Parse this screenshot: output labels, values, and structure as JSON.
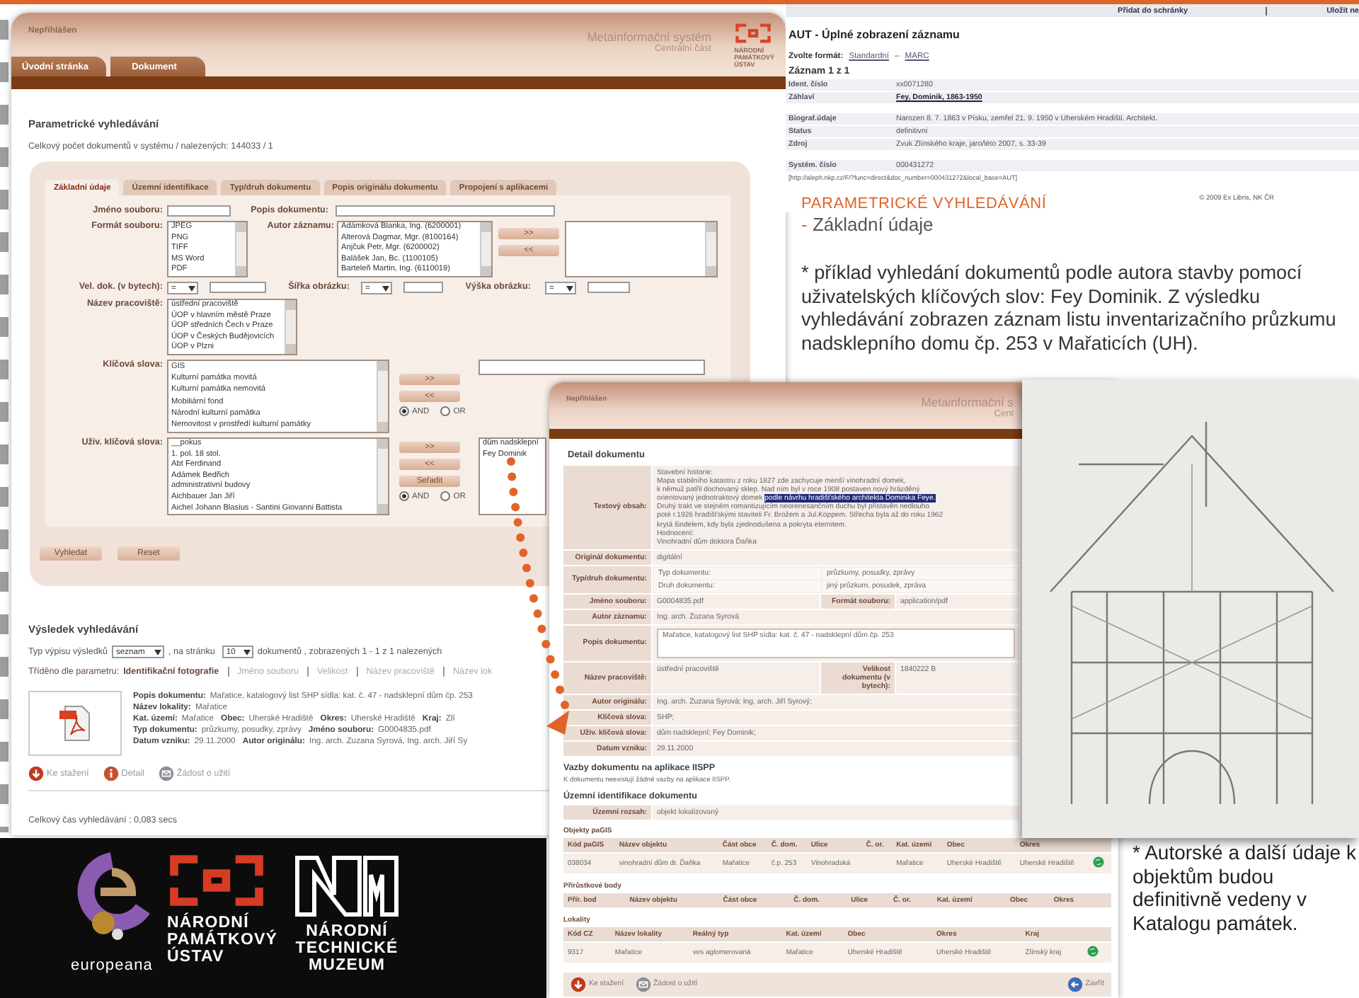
{
  "slide": {
    "heading": "PARAMETRICKÉ VYHLEDÁVÁNÍ",
    "subheading": "- Základní údaje",
    "note": "* příklad vyhledání dokumentů podle autora stavby pomocí uživatelských klíčových slov: Fey Dominik. Z výsledku vyhledávání zobrazen záznam listu inventarizačního průzkumu nadsklepního domu čp. 253 v Mařaticích (UH).",
    "footnote": "* Autorské a další údaje k objektům budou definitivně vedeny v Katalogu památek."
  },
  "search_window": {
    "status": "Nepřihlášen",
    "system_title": "Metainformační systém",
    "system_subtitle": "Centrální část",
    "logo_lines": [
      "NÁRODNÍ",
      "PAMÁTKOVÝ",
      "ÚSTAV"
    ],
    "nav_tabs": [
      "Úvodní stránka",
      "Dokument"
    ],
    "page_title": "Parametrické vyhledávání",
    "count_text": "Celkový počet dokumentů v systému / nalezených: 144033 / 1",
    "form": {
      "tabs": [
        {
          "label": "Základní údaje",
          "selected": true
        },
        {
          "label": "Územní identifikace",
          "selected": false
        },
        {
          "label": "Typ/druh dokumentu",
          "selected": false
        },
        {
          "label": "Popis originálu dokumentu",
          "selected": false
        },
        {
          "label": "Propojení s aplikacemi",
          "selected": false
        }
      ],
      "file_name_label": "Jméno souboru:",
      "description_label": "Popis dokumentu:",
      "format_label": "Formát souboru:",
      "formats": [
        "JPEG",
        "PNG",
        "TIFF",
        "MS Word",
        "PDF"
      ],
      "author_label": "Autor záznamu:",
      "authors": [
        "Adámková Blanka, Ing. (6200001)",
        "Alterová Dagmar, Mgr. (8100164)",
        "Anjčuk Petr, Mgr. (6200002)",
        "Balášek Jan, Bc. (1100105)",
        "Barteleň Martin, Ing. (6110019)"
      ],
      "author_buttons": [
        ">>",
        "<<"
      ],
      "size_label": "Vel. dok. (v bytech):",
      "size_operator": "=",
      "width_label": "Šířka obrázku:",
      "width_operator": "=",
      "height_label": "Výška obrázku:",
      "height_operator": "=",
      "workplace_label": "Název pracoviště:",
      "workplaces": [
        "ústřední pracoviště",
        "ÚOP v hlavním městě Praze",
        "ÚOP středních Čech v Praze",
        "ÚOP v Českých Budějovicích",
        "ÚOP v Plzni"
      ],
      "keywords_label": "Klíčová slova:",
      "keywords": [
        "GIS",
        "Kulturní památka movitá",
        "Kulturní památka nemovitá",
        "Mobiliární fond",
        "Národní kulturní památka",
        "Nemovitost v prostředí kulturní památky"
      ],
      "keyword_buttons": [
        ">>",
        "<<"
      ],
      "keyword_logic": [
        {
          "label": "AND",
          "selected": true
        },
        {
          "label": "OR",
          "selected": false
        }
      ],
      "user_keywords_label": "Uživ. klíčová slova:",
      "user_keywords": [
        "__pokus",
        "1. pol. 18 stol.",
        "Abt Ferdinand",
        "Adámek Bedřich",
        "administrativní budovy",
        "Aichbauer Jan Jiří",
        "Aichel Johann Blasius - Santini Giovanni Battista"
      ],
      "user_keyword_buttons": [
        ">>",
        "<<",
        "Seřadit"
      ],
      "user_keyword_logic": [
        {
          "label": "AND",
          "selected": true
        },
        {
          "label": "OR",
          "selected": false
        }
      ],
      "chosen_user_keywords": [
        "dům nadsklepní",
        "Fey Dominik"
      ],
      "search_button": "Vyhledat",
      "reset_button": "Reset"
    },
    "results": {
      "title": "Výsledek vyhledávání",
      "list_type_label": "Typ výpisu výsledků",
      "list_type": "seznam",
      "per_page_label": ", na stránku",
      "per_page": "10",
      "summary": "dokumentů , zobrazených 1 - 1 z 1 nalezených",
      "sort_label": "Tříděno dle parametru:",
      "sort_options": [
        {
          "label": "Identifikační fotografie",
          "selected": true
        },
        {
          "label": "Jméno souboru",
          "selected": false
        },
        {
          "label": "Velikost",
          "selected": false
        },
        {
          "label": "Název pracoviště",
          "selected": false
        },
        {
          "label": "Název lok",
          "selected": false
        }
      ],
      "item_lines": [
        [
          {
            "label": "Popis dokumentu:",
            "value": "Mařatice, katalogový list SHP sídla: kat. č. 47 - nadsklepní dům čp. 253"
          }
        ],
        [
          {
            "label": "Název lokality:",
            "value": "Mařatice"
          }
        ],
        [
          {
            "label": "Kat. území:",
            "value": "Mařatice"
          },
          {
            "label": "Obec:",
            "value": "Uherské Hradiště"
          },
          {
            "label": "Okres:",
            "value": "Uherské Hradiště"
          },
          {
            "label": "Kraj:",
            "value": "Zlí"
          }
        ],
        [
          {
            "label": "Typ dokumentu:",
            "value": "průzkumy, posudky, zprávy"
          },
          {
            "label": "Jméno souboru:",
            "value": "G0004835.pdf"
          }
        ],
        [
          {
            "label": "Datum vzniku:",
            "value": "29.11.2000"
          },
          {
            "label": "Autor originálu:",
            "value": "Ing. arch. Zuzana Syrová, Ing. arch. Jiří Sy"
          }
        ]
      ],
      "actions": [
        {
          "kind": "download",
          "label": "Ke stažení"
        },
        {
          "kind": "detail",
          "label": "Detail"
        },
        {
          "kind": "request",
          "label": "Žádost o užití"
        }
      ],
      "time": "Celkový čas vyhledávání : 0,083 secs"
    }
  },
  "aut_window": {
    "toolbar": [
      "Přidat do schránky",
      "Uložit ne"
    ],
    "title": "AUT - Úplné zobrazení záznamu",
    "format_label": "Zvolte formát:",
    "formats": [
      "Standardní",
      "MARC"
    ],
    "format_separator": "–",
    "record_count": "Záznam 1 z 1",
    "rows": [
      {
        "kind": "text",
        "label": "Ident. číslo",
        "value": "xx0071280"
      },
      {
        "kind": "link",
        "label": "Záhlaví",
        "value": "Fey, Dominik, 1863-1950"
      },
      {
        "kind": "text",
        "label": "Biograf.údaje",
        "value": "Narozen 8. 7. 1863 v Písku, zemřel 21. 9. 1950 v Uherském Hradišti. Architekt."
      },
      {
        "kind": "text",
        "label": "Status",
        "value": "definitivní"
      },
      {
        "kind": "text",
        "label": "Zdroj",
        "value": "Zvuk Zlínského kraje, jaro/léto 2007, s. 33-39"
      },
      {
        "kind": "text",
        "label": "Systém. číslo",
        "value": "000431272"
      }
    ],
    "url": "[http://aleph.nkp.cz/F/?func=direct&doc_number=000431272&local_base=AUT]",
    "copyright": "© 2009 Ex Libris, NK ČR"
  },
  "detail_window": {
    "status": "Nepřihlášen",
    "system_title": "Metainformační s",
    "system_subtitle": "Cent",
    "title": "Detail dokumentu",
    "rows": [
      {
        "kind": "content",
        "label": "Textový obsah:",
        "lines": [
          [
            {
              "text": "Stavební historie:",
              "highlighted": false
            }
          ],
          [
            {
              "text": "Mapa stabilního katastru z roku 1827 zde zachycuje menší vinohradní domek,",
              "highlighted": false
            }
          ],
          [
            {
              "text": "k němuž patřil dochovaný sklep. Nad ním byl v roce 1908 postaven nový hrázděný",
              "highlighted": false
            }
          ],
          [
            {
              "text": "orientovaný jednotraktový domek ",
              "highlighted": false
            },
            {
              "text": "podle návrhu hradišťského architekta Dominika Feye.",
              "highlighted": true
            }
          ],
          [
            {
              "text": "Druhý trakt ve stejném romantizujícím neorenesančním duchu byl přistavěn nedlouho",
              "highlighted": false
            }
          ],
          [
            {
              "text": "poté r.1926 hradišťskými staviteli Fr. Brožem a Jul.Koppem. Střecha byla až do roku 1962",
              "highlighted": false
            }
          ],
          [
            {
              "text": "krytá šindelem, kdy byla zjednodušena a pokryta eternitem.",
              "highlighted": false
            }
          ],
          [
            {
              "text": "Hodnocení:",
              "highlighted": false
            }
          ],
          [
            {
              "text": "Vinohradní dům doktora Ďaňka",
              "highlighted": false
            }
          ]
        ]
      },
      {
        "kind": "text",
        "label": "Originál dokumentu:",
        "value": "digitální"
      },
      {
        "kind": "subtable",
        "label": "Typ/druh dokumentu:",
        "pairs": [
          [
            "Typ dokumentu:",
            "průzkumy, posudky, zprávy"
          ],
          [
            "Druh dokumentu:",
            "jiný průzkum, posudek, zpráva"
          ]
        ]
      },
      {
        "kind": "split",
        "label": "Jméno souboru:",
        "value": "G0004835.pdf",
        "label2": "Formát souboru:",
        "value2": "application/pdf"
      },
      {
        "kind": "text",
        "label": "Autor záznamu:",
        "value": "Ing. arch. Zuzana Syrová"
      },
      {
        "kind": "textarea",
        "label": "Popis dokumentu:",
        "value": "Mařatice, katalogový list SHP sídla: kat. č. 47 - nadsklepní dům čp. 253"
      },
      {
        "kind": "split",
        "label": "Název pracoviště:",
        "value": "ústřední pracoviště",
        "label2": "Velikost dokumentu (v bytech):",
        "value2": "1840222 B"
      },
      {
        "kind": "text",
        "label": "Autor originálu:",
        "value": "Ing. arch. Zuzana Syrová; Ing. arch. Jiří Syrový;"
      },
      {
        "kind": "text",
        "label": "Klíčová slova:",
        "value": "SHP;"
      },
      {
        "kind": "text",
        "label": "Uživ. klíčová slova:",
        "value": "dům nadsklepní; Fey Dominik;"
      },
      {
        "kind": "text",
        "label": "Datum vzniku:",
        "value": "29.11.2000"
      }
    ],
    "links_title": "Vazby dokumentu na aplikace IISPP",
    "links_note": "K dokumentu neexistují žádné vazby na aplikace IISPP.",
    "territory_title": "Územní identifikace dokumentu",
    "territory_label": "Územní rozsah:",
    "territory_value": "objekt lokalizovaný",
    "tables": [
      {
        "title": "Objekty paGIS",
        "columns": [
          "Kód paGIS",
          "Název objektu",
          "Část obce",
          "Č. dom.",
          "Ulice",
          "Č. or.",
          "Kat. území",
          "Obec",
          "Okres"
        ],
        "rows": [
          [
            "038034",
            "vinohradní dům dr. Ďaňka",
            "Mařatice",
            "č.p. 253",
            "Vinohradská",
            null,
            "Mařatice",
            "Uherské Hradiště",
            "Uherské Hradiště"
          ]
        ]
      },
      {
        "title": "Přírůstkové body",
        "columns": [
          "Přír. bod",
          "Název objektu",
          "Část obce",
          "Č. dom.",
          "Ulice",
          "Č. or.",
          "Kat. území",
          "Obec",
          "Okres"
        ]
      },
      {
        "title": "Lokality",
        "columns": [
          "Kód CZ",
          "Název lokality",
          "Reálný typ",
          "Kat. území",
          "Obec",
          "Okres",
          "Kraj"
        ],
        "rows": [
          [
            "9317",
            "Mařatice",
            "ves aglomerovaná",
            "Mařatice",
            "Uherské Hradiště",
            "Uherské Hradiště",
            "Zlínský kraj"
          ]
        ]
      }
    ],
    "actions": [
      {
        "kind": "download",
        "label": "Ke stažení"
      },
      {
        "kind": "request",
        "label": "Žádost o užití"
      },
      {
        "kind": "close",
        "label": "Zavřít"
      }
    ]
  },
  "logos": [
    {
      "kind": "europeana",
      "lines": [
        "europeana"
      ]
    },
    {
      "kind": "npu",
      "lines": [
        "NÁRODNÍ",
        "PAMÁTKOVÝ",
        "ÚSTAV"
      ]
    },
    {
      "kind": "ntm",
      "lines": [
        "NÁRODNÍ",
        "TECHNICKÉ",
        "MUZEUM"
      ]
    }
  ]
}
